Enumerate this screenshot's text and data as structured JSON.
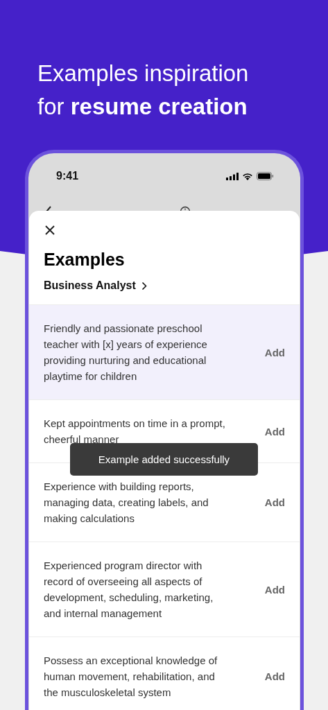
{
  "headline": [
    "Examples inspiration",
    "for **resume creation**"
  ],
  "status_bar": {
    "time": "9:41"
  },
  "sheet": {
    "title": "Examples",
    "category": "Business Analyst",
    "items": [
      {
        "text": "Friendly and passionate preschool teacher with [x] years of experience providing nurturing and educational playtime for children",
        "action": "Add",
        "selected": true
      },
      {
        "text": "Kept appointments on time in a prompt, cheerful manner",
        "action": "Add",
        "selected": false
      },
      {
        "text": "Experience with building reports, managing data, creating labels, and making calculations",
        "action": "Add",
        "selected": false
      },
      {
        "text": "Experienced program director with record of overseeing all aspects of development, scheduling, marketing, and internal management",
        "action": "Add",
        "selected": false
      },
      {
        "text": "Possess an exceptional knowledge of human movement, rehabilitation, and the musculoskeletal system",
        "action": "Add",
        "selected": false
      }
    ]
  },
  "toast": "Example added successfully"
}
